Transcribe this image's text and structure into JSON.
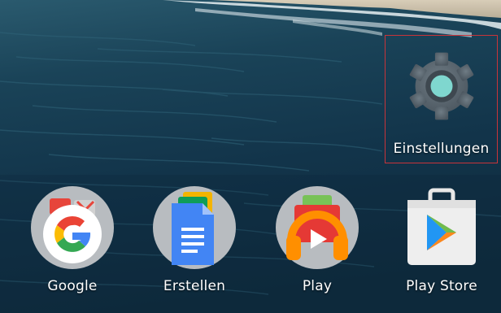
{
  "home_screen": {
    "top_apps": [
      {
        "label": "Einstellungen",
        "icon": "settings-gear-icon",
        "highlighted": true
      }
    ],
    "dock_apps": [
      {
        "label": "Google",
        "icon": "google-folder-icon"
      },
      {
        "label": "Erstellen",
        "icon": "docs-folder-icon"
      },
      {
        "label": "Play",
        "icon": "play-music-folder-icon"
      },
      {
        "label": "Play Store",
        "icon": "play-store-icon"
      }
    ]
  },
  "colors": {
    "wallpaper_ocean": "#123548",
    "highlight_border": "#c8343a",
    "settings_gear": "#5f6b74",
    "settings_center": "#7fd7cf",
    "label_text": "#ffffff"
  }
}
